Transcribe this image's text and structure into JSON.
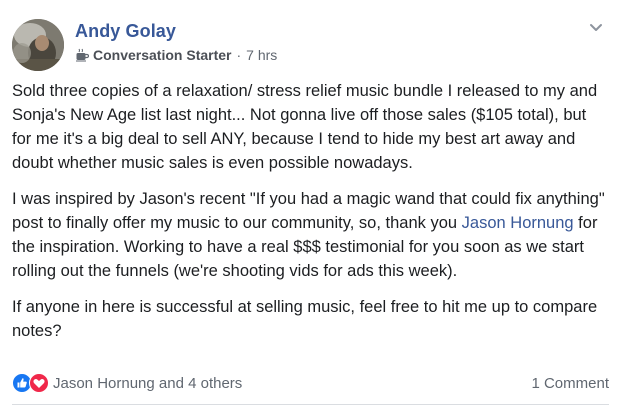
{
  "post": {
    "author": "Andy Golay",
    "badge": "Conversation Starter",
    "separator": "·",
    "time": "7 hrs",
    "paragraphs": {
      "p1": "Sold three copies of a relaxation/ stress relief music bundle I released to my and Sonja's New Age list last night... Not gonna live off those sales ($105 total), but for me it's a big deal to sell ANY, because I tend to hide my best art away and doubt whether music sales is even possible nowadays.",
      "p2_before": "I was inspired by Jason's recent \"If you had a magic wand that could fix anything\" post to finally offer my music to our community, so, thank you ",
      "p2_mention": "Jason Hornung",
      "p2_after": " for the inspiration. Working to have a real $$$ testimonial for you soon as we start rolling out the funnels (we're shooting vids for ads this week).",
      "p3": "If anyone in here is successful at selling music, feel free to hit me up to compare notes?"
    },
    "reactions": {
      "icons": [
        "like-icon",
        "love-icon"
      ],
      "summary": "Jason Hornung and 4 others"
    },
    "comments": "1 Comment"
  },
  "colors": {
    "link": "#385898",
    "meta": "#606770",
    "like_blue": "#1877f2",
    "love_red": "#f0284a"
  }
}
